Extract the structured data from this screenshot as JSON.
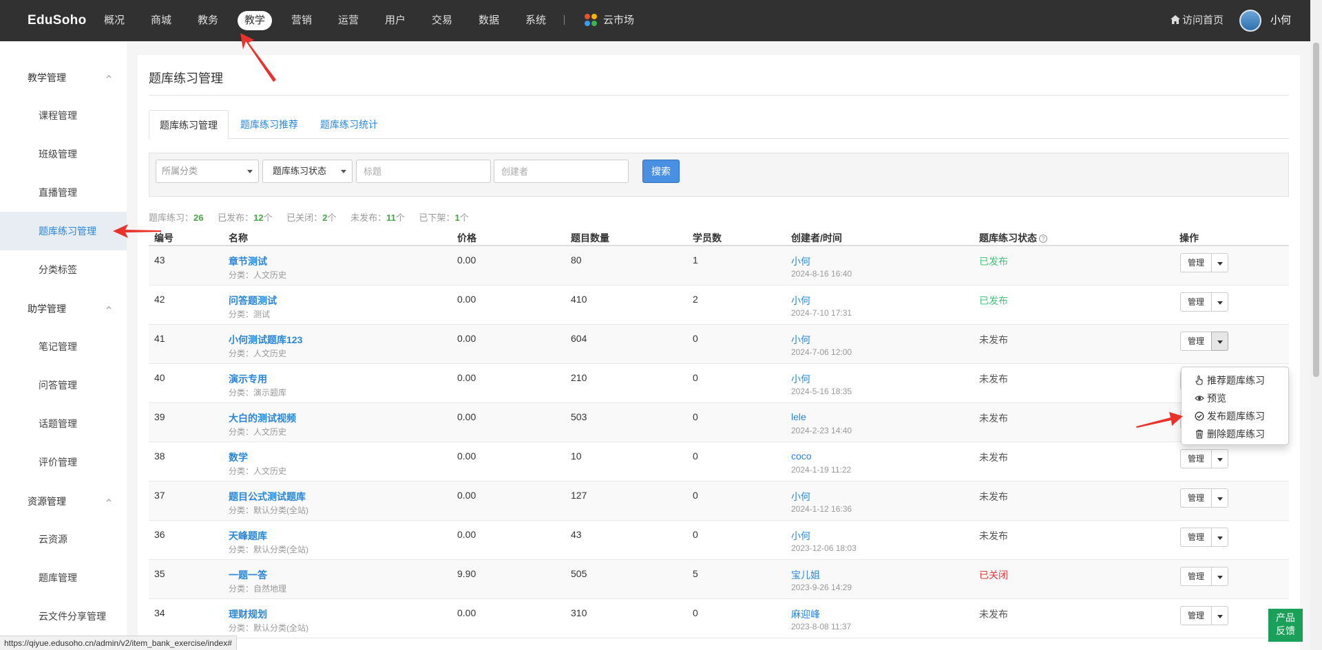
{
  "topbar": {
    "logo": "EduSoho",
    "nav": [
      "概况",
      "商城",
      "教务",
      "教学",
      "营销",
      "运营",
      "用户",
      "交易",
      "数据",
      "系统"
    ],
    "active_nav": "教学",
    "cloud_market": "云市场",
    "home_link": "访问首页",
    "user": "小何"
  },
  "sidebar": {
    "groups": [
      {
        "title": "教学管理",
        "items": [
          "课程管理",
          "班级管理",
          "直播管理",
          "题库练习管理",
          "分类标签"
        ]
      },
      {
        "title": "助学管理",
        "items": [
          "笔记管理",
          "问答管理",
          "话题管理",
          "评价管理"
        ]
      },
      {
        "title": "资源管理",
        "items": [
          "云资源",
          "题库管理",
          "云文件分享管理"
        ]
      }
    ],
    "active_item": "题库练习管理"
  },
  "page": {
    "title": "题库练习管理",
    "tabs": [
      "题库练习管理",
      "题库练习推荐",
      "题库练习统计"
    ],
    "active_tab": "题库练习管理"
  },
  "filters": {
    "category": "所属分类",
    "status": "题库练习状态",
    "title_placeholder": "标题",
    "creator_placeholder": "创建者",
    "search_label": "搜索"
  },
  "stats": [
    {
      "label": "题库练习：",
      "value": "26",
      "unit": ""
    },
    {
      "label": "已发布：",
      "value": "12",
      "unit": "个"
    },
    {
      "label": "已关闭：",
      "value": "2",
      "unit": "个"
    },
    {
      "label": "未发布：",
      "value": "11",
      "unit": "个"
    },
    {
      "label": "已下架：",
      "value": "1",
      "unit": "个"
    }
  ],
  "table": {
    "headers": [
      "编号",
      "名称",
      "价格",
      "题目数量",
      "学员数",
      "创建者/时间",
      "题库练习状态",
      "操作"
    ],
    "manage_label": "管理",
    "rows": [
      {
        "id": "43",
        "name": "章节测试",
        "category": "分类：人文历史",
        "price": "0.00",
        "questions": "80",
        "students": "1",
        "creator": "小何",
        "time": "2024-8-16 16:40",
        "status": "已发布",
        "status_type": "pub"
      },
      {
        "id": "42",
        "name": "问答题测试",
        "category": "分类：测试",
        "price": "0.00",
        "questions": "410",
        "students": "2",
        "creator": "小何",
        "time": "2024-7-10 17:31",
        "status": "已发布",
        "status_type": "pub"
      },
      {
        "id": "41",
        "name": "小何测试题库123",
        "category": "分类：人文历史",
        "price": "0.00",
        "questions": "604",
        "students": "0",
        "creator": "小何",
        "time": "2024-7-06 12:00",
        "status": "未发布",
        "status_type": "none"
      },
      {
        "id": "40",
        "name": "演示专用",
        "category": "分类：演示题库",
        "price": "0.00",
        "questions": "210",
        "students": "0",
        "creator": "小何",
        "time": "2024-5-16 18:35",
        "status": "未发布",
        "status_type": "none"
      },
      {
        "id": "39",
        "name": "大白的测试视频",
        "category": "分类：人文历史",
        "price": "0.00",
        "questions": "503",
        "students": "0",
        "creator": "lele",
        "time": "2024-2-23 14:40",
        "status": "未发布",
        "status_type": "none"
      },
      {
        "id": "38",
        "name": "数学",
        "category": "分类：人文历史",
        "price": "0.00",
        "questions": "10",
        "students": "0",
        "creator": "coco",
        "time": "2024-1-19 11:22",
        "status": "未发布",
        "status_type": "none"
      },
      {
        "id": "37",
        "name": "题目公式测试题库",
        "category": "分类：默认分类(全站)",
        "price": "0.00",
        "questions": "127",
        "students": "0",
        "creator": "小何",
        "time": "2024-1-12 16:36",
        "status": "未发布",
        "status_type": "none"
      },
      {
        "id": "36",
        "name": "天峰题库",
        "category": "分类：默认分类(全站)",
        "price": "0.00",
        "questions": "43",
        "students": "0",
        "creator": "小何",
        "time": "2023-12-06 18:03",
        "status": "未发布",
        "status_type": "none"
      },
      {
        "id": "35",
        "name": "一题一答",
        "category": "分类：自然地理",
        "price": "9.90",
        "questions": "505",
        "students": "5",
        "creator": "宝儿姐",
        "time": "2023-9-26 14:29",
        "status": "已关闭",
        "status_type": "closed"
      },
      {
        "id": "34",
        "name": "理财规划",
        "category": "分类：默认分类(全站)",
        "price": "0.00",
        "questions": "310",
        "students": "0",
        "creator": "麻迎峰",
        "time": "2023-8-08 11:37",
        "status": "未发布",
        "status_type": "none"
      }
    ]
  },
  "dropdown": {
    "items": [
      {
        "label": "推荐题库练习",
        "icon": "hand-pointer-icon"
      },
      {
        "label": "预览",
        "icon": "eye-icon"
      },
      {
        "label": "发布题库练习",
        "icon": "check-circle-icon"
      },
      {
        "label": "删除题库练习",
        "icon": "trash-icon"
      }
    ]
  },
  "statusbar": "https://qiyue.edusoho.cn/admin/v2/item_bank_exercise/index#",
  "feedback": [
    "产品",
    "反馈"
  ],
  "colors": {
    "topbar": "#313131",
    "link": "#2a87d8",
    "published": "#46c37b",
    "closed": "#e4393c",
    "stat_number": "#46a546",
    "search_button": "#4a90e2",
    "feedback": "#1aa058",
    "annotation_arrow": "#e8322b"
  }
}
